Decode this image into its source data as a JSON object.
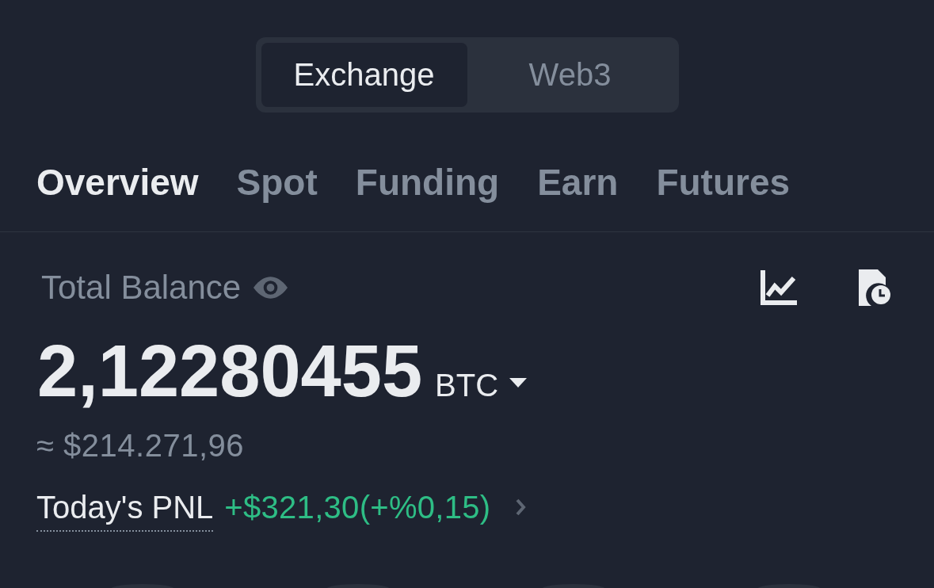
{
  "segments": [
    {
      "label": "Exchange",
      "selected": true
    },
    {
      "label": "Web3",
      "selected": false
    }
  ],
  "tabs": [
    {
      "label": "Overview",
      "selected": true
    },
    {
      "label": "Spot",
      "selected": false
    },
    {
      "label": "Funding",
      "selected": false
    },
    {
      "label": "Earn",
      "selected": false
    },
    {
      "label": "Futures",
      "selected": false
    }
  ],
  "balance": {
    "label": "Total Balance",
    "amount": "2,12280455",
    "currency": "BTC",
    "fiat_value": "≈ $214.271,96"
  },
  "pnl": {
    "label": "Today's PNL",
    "value": "+$321,30(+%0,15)",
    "gain": true
  }
}
